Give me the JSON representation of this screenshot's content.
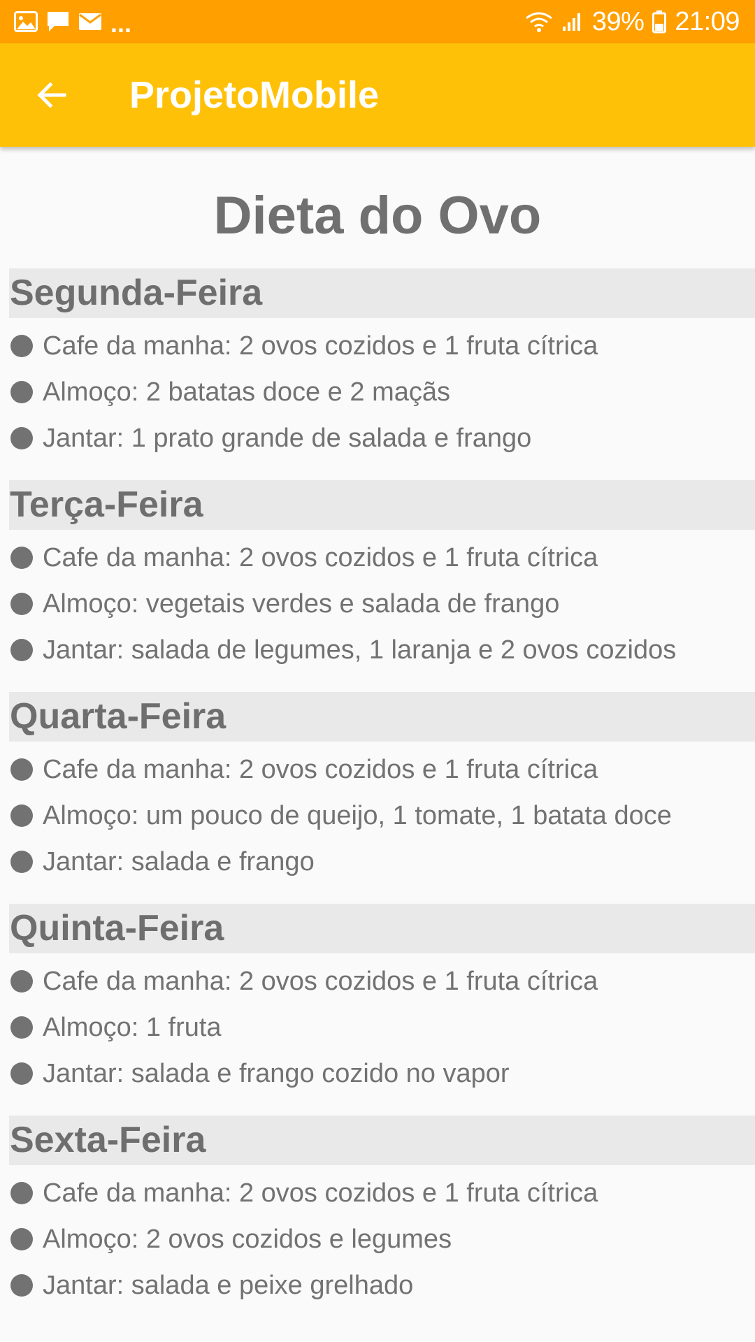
{
  "status_bar": {
    "ellipsis": "...",
    "battery": "39%",
    "time": "21:09",
    "icons": [
      "image-icon",
      "message-icon",
      "email-icon",
      "wifi-icon",
      "signal-icon",
      "battery-icon"
    ]
  },
  "app_bar": {
    "title": "ProjetoMobile",
    "back_icon": "arrow-back-icon"
  },
  "page": {
    "title": "Dieta do Ovo"
  },
  "days": [
    {
      "name": "Segunda-Feira",
      "meals": [
        "Cafe da manha: 2 ovos cozidos e 1 fruta cítrica",
        "Almoço: 2 batatas doce e 2 maçãs",
        "Jantar: 1 prato grande de salada e frango"
      ]
    },
    {
      "name": "Terça-Feira",
      "meals": [
        "Cafe da manha: 2 ovos cozidos e 1 fruta cítrica",
        "Almoço: vegetais verdes e salada de frango",
        "Jantar: salada de legumes, 1 laranja e 2 ovos cozidos"
      ]
    },
    {
      "name": "Quarta-Feira",
      "meals": [
        "Cafe da manha: 2 ovos cozidos e 1 fruta cítrica",
        "Almoço: um pouco de queijo, 1 tomate, 1 batata doce",
        "Jantar: salada e frango"
      ]
    },
    {
      "name": "Quinta-Feira",
      "meals": [
        "Cafe da manha: 2 ovos cozidos e 1 fruta cítrica",
        "Almoço: 1 fruta",
        "Jantar: salada e frango cozido no vapor"
      ]
    },
    {
      "name": "Sexta-Feira",
      "meals": [
        "Cafe da manha: 2 ovos cozidos e 1 fruta cítrica",
        "Almoço: 2 ovos cozidos e legumes",
        "Jantar: salada e peixe grelhado"
      ]
    }
  ],
  "colors": {
    "status_bar": "#ffa000",
    "app_bar": "#ffc107",
    "text": "#727272",
    "day_header_bg": "#e9e9e9",
    "background": "#fafafa"
  }
}
